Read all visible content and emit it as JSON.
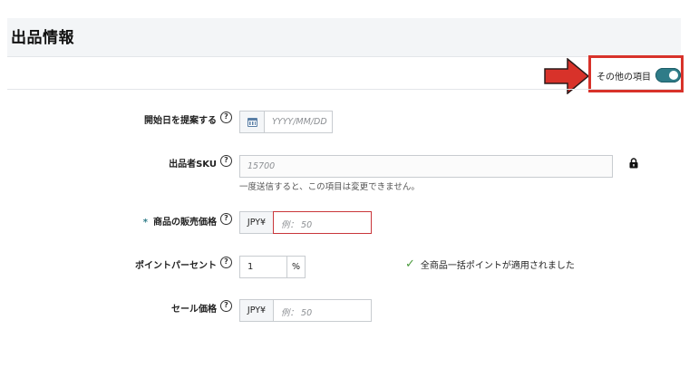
{
  "header": {
    "title": "出品情報"
  },
  "toolbar": {
    "other_items_label": "その他の項目",
    "other_items_on": true
  },
  "fields": {
    "start_date": {
      "label": "開始日を提案する",
      "help": "?",
      "placeholder": "YYYY/MM/DD",
      "icon": "calendar-icon"
    },
    "sku": {
      "label": "出品者SKU",
      "help": "?",
      "value": "15700",
      "note": "一度送信すると、この項目は変更できません。",
      "icon": "lock-icon"
    },
    "price": {
      "required_mark": "*",
      "label": "商品の販売価格",
      "help": "?",
      "currency": "JPY¥",
      "placeholder": "例： 50"
    },
    "points": {
      "label": "ポイントパーセント",
      "help": "?",
      "value": "1",
      "unit": "%",
      "applied_text": "全商品一括ポイントが適用されました"
    },
    "sale_price": {
      "label": "セール価格",
      "help": "?",
      "currency": "JPY¥",
      "placeholder": "例： 50"
    }
  },
  "colors": {
    "accent": "#2f7c88",
    "highlight": "#d8322a",
    "error_border": "#c9363a",
    "check": "#4a9a3d"
  }
}
